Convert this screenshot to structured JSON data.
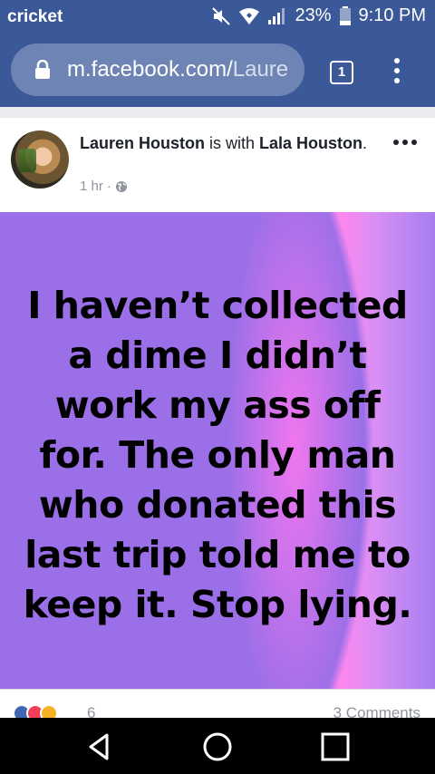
{
  "status_bar": {
    "carrier": "cricket",
    "battery_percent": "23%",
    "time": "9:10 PM",
    "icons": [
      "mute-icon",
      "wifi-icon",
      "signal-icon",
      "battery-icon"
    ]
  },
  "browser": {
    "url_domain": "m.facebook.com/",
    "url_path": "Laure",
    "tab_count": "1",
    "icons": [
      "lock-icon",
      "more-vert-icon"
    ]
  },
  "post": {
    "author": "Lauren Houston",
    "with_text": " is with ",
    "tagged_user": "Lala Houston",
    "tagged_suffix": ".",
    "time": "1 hr",
    "separator": " · ",
    "privacy_icon": "globe-icon",
    "text": "I haven’t collected a dime I didn’t work my ass off for. The only man who donated this last trip told me to keep it. Stop lying.",
    "background_colors": {
      "base": "#9b6fe8",
      "highlight": "#ff86ef"
    }
  },
  "reactions": {
    "icons": [
      "like-icon",
      "love-icon",
      "haha-icon"
    ],
    "count": "6",
    "comments": "3 Comments"
  },
  "nav_bar": {
    "icons": [
      "back-icon",
      "home-icon",
      "recents-icon"
    ]
  },
  "colors": {
    "facebook_blue": "#3b5998",
    "url_pill": "#6d84b4",
    "meta_grey": "#90949c"
  }
}
